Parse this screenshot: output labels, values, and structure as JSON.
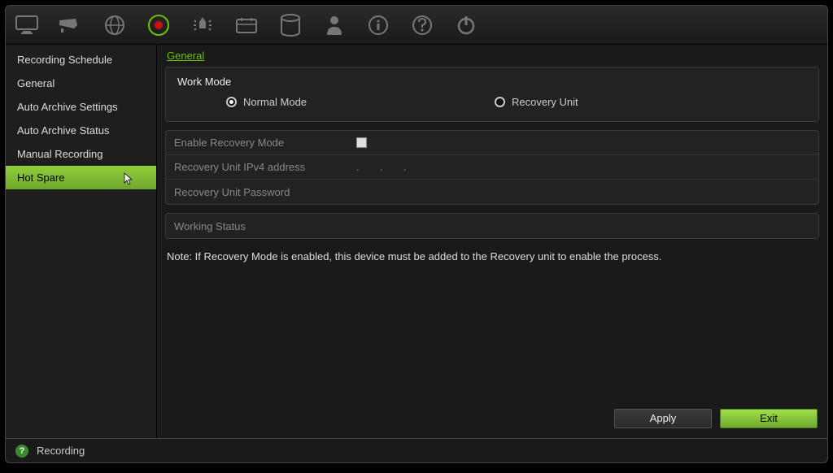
{
  "toolbar_icons": [
    "monitor-icon",
    "camera-icon",
    "globe-icon",
    "record-icon",
    "alarm-icon",
    "schedule-icon",
    "hdd-icon",
    "user-icon",
    "info-icon",
    "help-icon",
    "power-icon"
  ],
  "sidebar": {
    "items": [
      {
        "label": "Recording Schedule"
      },
      {
        "label": "General"
      },
      {
        "label": "Auto Archive Settings"
      },
      {
        "label": "Auto Archive Status"
      },
      {
        "label": "Manual Recording"
      },
      {
        "label": "Hot Spare"
      }
    ],
    "active_index": 5
  },
  "tab": {
    "label": "General"
  },
  "work_mode": {
    "title": "Work Mode",
    "options": [
      {
        "label": "Normal Mode",
        "checked": true
      },
      {
        "label": "Recovery Unit",
        "checked": false
      }
    ]
  },
  "form": {
    "rows": [
      {
        "label": "Enable Recovery Mode",
        "type": "checkbox",
        "value": ""
      },
      {
        "label": "Recovery Unit IPv4 address",
        "type": "text",
        "value": ".       .       ."
      },
      {
        "label": "Recovery Unit Password",
        "type": "text",
        "value": ""
      }
    ]
  },
  "status": {
    "label": "Working Status",
    "value": ""
  },
  "note": "Note: If Recovery Mode is enabled, this device must be added to the Recovery unit to enable the process.",
  "buttons": {
    "apply": "Apply",
    "exit": "Exit"
  },
  "statusbar": {
    "label": "Recording"
  }
}
